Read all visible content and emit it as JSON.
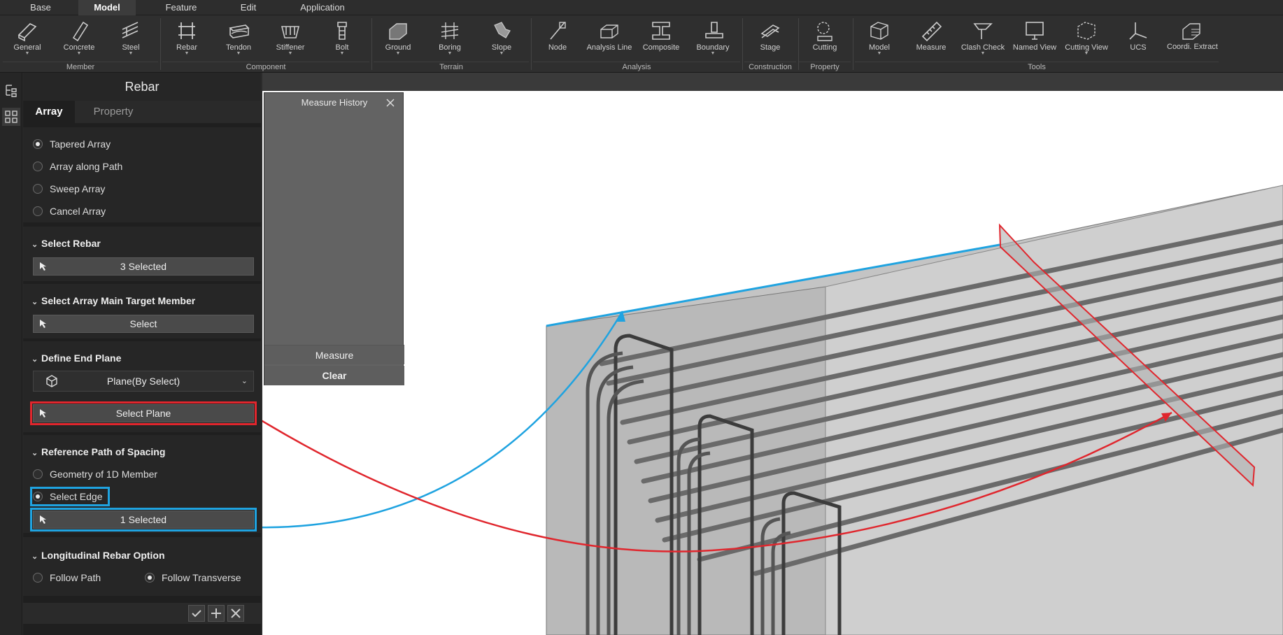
{
  "menubar": {
    "items": [
      "Base",
      "Model",
      "Feature",
      "Edit",
      "Application"
    ],
    "active": "Model"
  },
  "ribbon": {
    "groups": [
      {
        "label": "Member",
        "tools": [
          "General",
          "Concrete",
          "Steel"
        ]
      },
      {
        "label": "Component",
        "tools": [
          "Rebar",
          "Tendon",
          "Stiffener",
          "Bolt"
        ]
      },
      {
        "label": "Terrain",
        "tools": [
          "Ground",
          "Boring",
          "Slope"
        ]
      },
      {
        "label": "Analysis",
        "tools": [
          "Node",
          "Analysis Line",
          "Composite",
          "Boundary"
        ]
      },
      {
        "label": "Construction",
        "tools": [
          "Stage"
        ]
      },
      {
        "label": "Property",
        "tools": [
          "Cutting"
        ]
      },
      {
        "label": "Tools",
        "tools": [
          "Model",
          "Measure",
          "Clash Check",
          "Named View",
          "Cutting View",
          "UCS",
          "Coordi. Extract"
        ]
      }
    ]
  },
  "panel": {
    "title": "Rebar",
    "tabs": [
      "Array",
      "Property"
    ],
    "array_types": [
      "Tapered Array",
      "Array along Path",
      "Sweep Array",
      "Cancel Array"
    ],
    "selected_array_type": "Tapered Array",
    "select_rebar": {
      "heading": "Select Rebar",
      "button": "3 Selected"
    },
    "select_target": {
      "heading": "Select Array Main Target Member",
      "button": "Select"
    },
    "end_plane": {
      "heading": "Define End Plane",
      "dropdown": "Plane(By Select)",
      "button": "Select Plane"
    },
    "ref_path": {
      "heading": "Reference Path of Spacing",
      "options": [
        "Geometry of 1D Member",
        "Select Edge"
      ],
      "selected": "Select Edge",
      "button": "1 Selected"
    },
    "long_option": {
      "heading": "Longitudinal Rebar Option",
      "options": [
        "Follow Path",
        "Follow Transverse"
      ],
      "selected": "Follow Transverse"
    }
  },
  "measure_history": {
    "title": "Measure History",
    "measure": "Measure",
    "clear": "Clear"
  },
  "colors": {
    "highlight_red": "#e0262d",
    "highlight_blue": "#1fa3e0",
    "panel_bg": "#1f1f1f"
  }
}
